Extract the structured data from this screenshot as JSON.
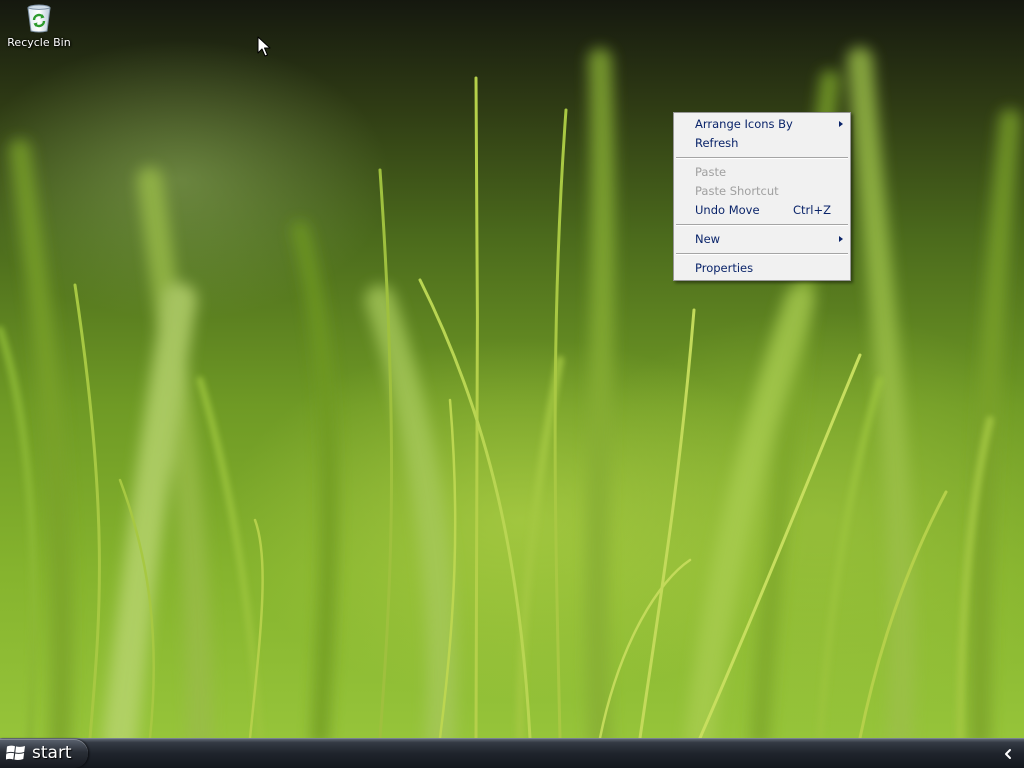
{
  "desktop": {
    "icons": [
      {
        "label": "Recycle Bin",
        "icon": "recycle-bin-icon"
      }
    ]
  },
  "context_menu": {
    "items": [
      {
        "label": "Arrange Icons By",
        "enabled": true,
        "submenu": true
      },
      {
        "label": "Refresh",
        "enabled": true
      },
      {
        "separator": true
      },
      {
        "label": "Paste",
        "enabled": false
      },
      {
        "label": "Paste Shortcut",
        "enabled": false
      },
      {
        "label": "Undo Move",
        "enabled": true,
        "shortcut": "Ctrl+Z"
      },
      {
        "separator": true
      },
      {
        "label": "New",
        "enabled": true,
        "submenu": true
      },
      {
        "separator": true
      },
      {
        "label": "Properties",
        "enabled": true
      }
    ]
  },
  "taskbar": {
    "start_label": "start",
    "start_icon": "windows-logo-icon",
    "tray_icon": "chevron-left-icon"
  },
  "colors": {
    "menu_text": "#0a246a",
    "menu_disabled": "#a0a0a0",
    "taskbar": "#1f242c"
  }
}
